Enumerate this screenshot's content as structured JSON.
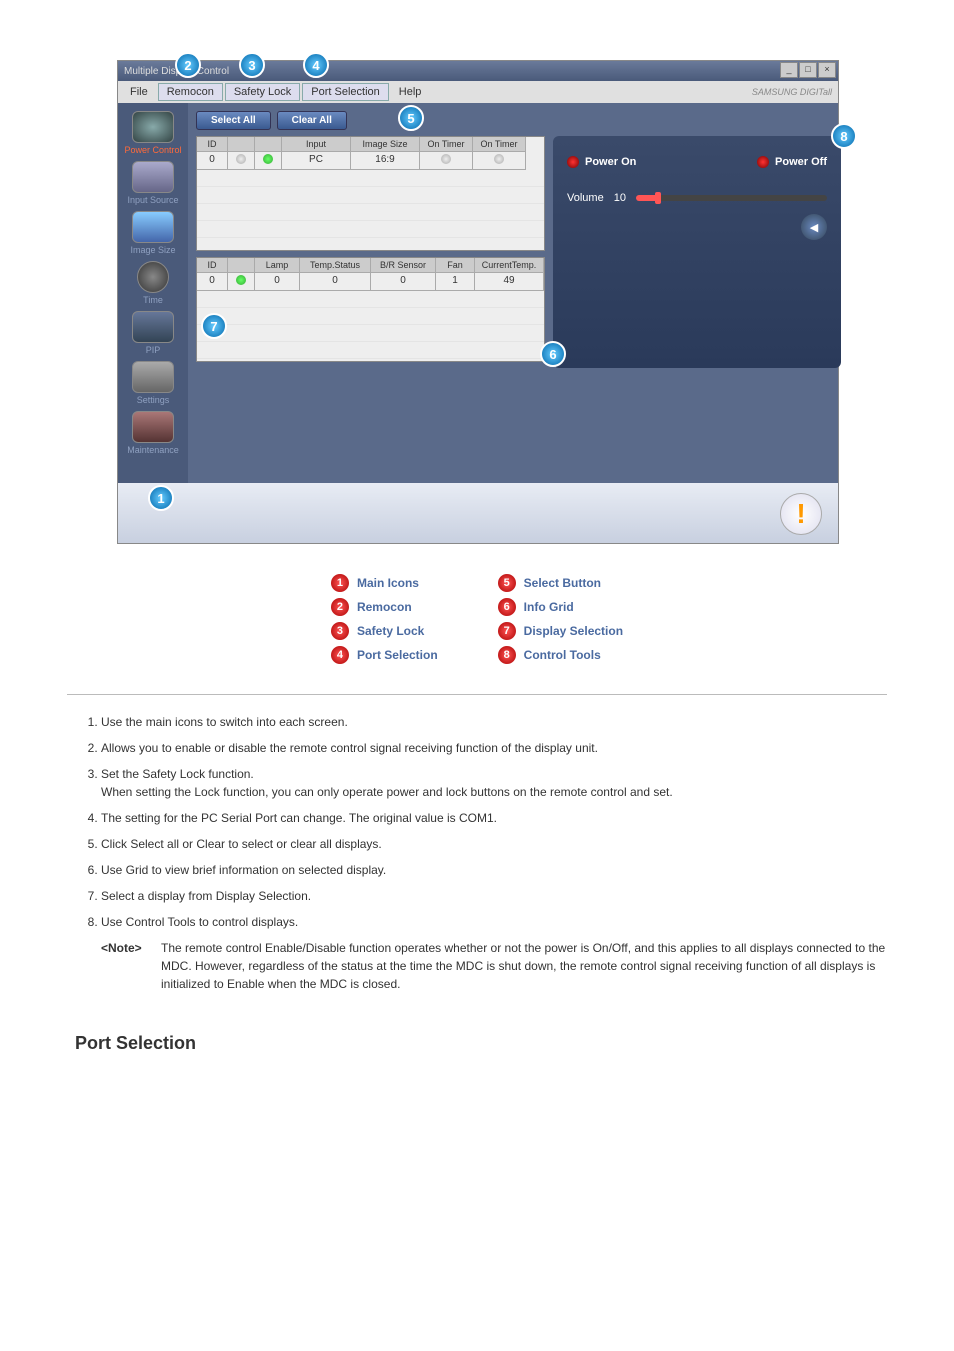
{
  "window": {
    "title": "Multiple Display Control",
    "brand": "SAMSUNG DIGITall"
  },
  "menubar": {
    "file": "File",
    "remocon": "Remocon",
    "safety_lock": "Safety Lock",
    "port_selection": "Port Selection",
    "help": "Help"
  },
  "sidebar": {
    "power": "Power Control",
    "input": "Input Source",
    "image": "Image Size",
    "time": "Time",
    "pip": "PIP",
    "settings": "Settings",
    "maintenance": "Maintenance"
  },
  "buttons": {
    "select_all": "Select All",
    "clear_all": "Clear All"
  },
  "grid1": {
    "headers": [
      "ID",
      "",
      "",
      "Input",
      "Image Size",
      "On Timer",
      "On Timer"
    ],
    "row": [
      "0",
      "",
      "",
      "PC",
      "16:9",
      "",
      ""
    ]
  },
  "grid2": {
    "headers": [
      "ID",
      "",
      "Lamp",
      "Temp.Status",
      "B/R Sensor",
      "Fan",
      "CurrentTemp."
    ],
    "row": [
      "0",
      "",
      "0",
      "0",
      "0",
      "1",
      "49"
    ]
  },
  "right_panel": {
    "power_on": "Power On",
    "power_off": "Power Off",
    "volume_label": "Volume",
    "volume_value": "10"
  },
  "legend": {
    "l1": "Main Icons",
    "l2": "Remocon",
    "l3": "Safety Lock",
    "l4": "Port Selection",
    "l5": "Select Button",
    "l6": "Info Grid",
    "l7": "Display Selection",
    "l8": "Control Tools"
  },
  "notes": {
    "n1": "Use the main icons to switch into each screen.",
    "n2": "Allows you to enable or disable the remote control signal receiving function of the display unit.",
    "n3a": "Set the Safety Lock function.",
    "n3b": "When setting the Lock function, you can only operate power and lock buttons on the remote control and set.",
    "n4": "The setting for the PC Serial Port can change. The original value is COM1.",
    "n5": "Click Select all or Clear to select or clear all displays.",
    "n6": "Use Grid to view brief information on selected display.",
    "n7": "Select a display from Display Selection.",
    "n8": "Use Control Tools to control displays.",
    "note_label": "<Note>",
    "note_text": "The remote control Enable/Disable function operates whether or not the power is On/Off, and this applies to all displays connected to the MDC. However, regardless of the status at the time the MDC is shut down, the remote control signal receiving function of all displays is initialized to Enable when the MDC is closed."
  },
  "section_heading": "Port Selection"
}
